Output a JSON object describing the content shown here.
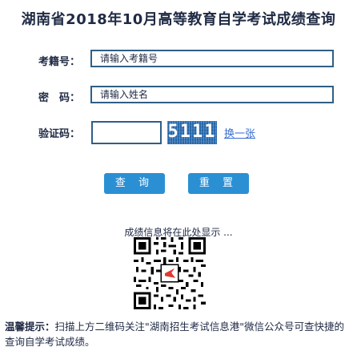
{
  "title": "湖南省2018年10月高等教育自学考试成绩查询",
  "form": {
    "exam_no_label": "考籍号：",
    "exam_no_placeholder": "请输入考籍号",
    "name_label": "密　码：",
    "name_placeholder": "请输入姓名",
    "captcha_label": "验证码：",
    "captcha_value": "",
    "captcha_code": "5111",
    "swap_link": "换一张"
  },
  "buttons": {
    "query": "查 询",
    "reset": "重 置"
  },
  "result_hint": "成绩信息将在此处显示 ...",
  "notice": {
    "label": "温馨提示：",
    "text": "扫描上方二维码关注\"湖南招生考试信息港\"微信公众号可查快捷的查询自学考试成绩。"
  },
  "colors": {
    "button_bg": "#2b8fd4",
    "field_border": "#2f5f86",
    "captcha_bg": "#2d6fb3",
    "link": "#3a6fcf"
  },
  "icons": {
    "qr": "qr-code-icon"
  }
}
